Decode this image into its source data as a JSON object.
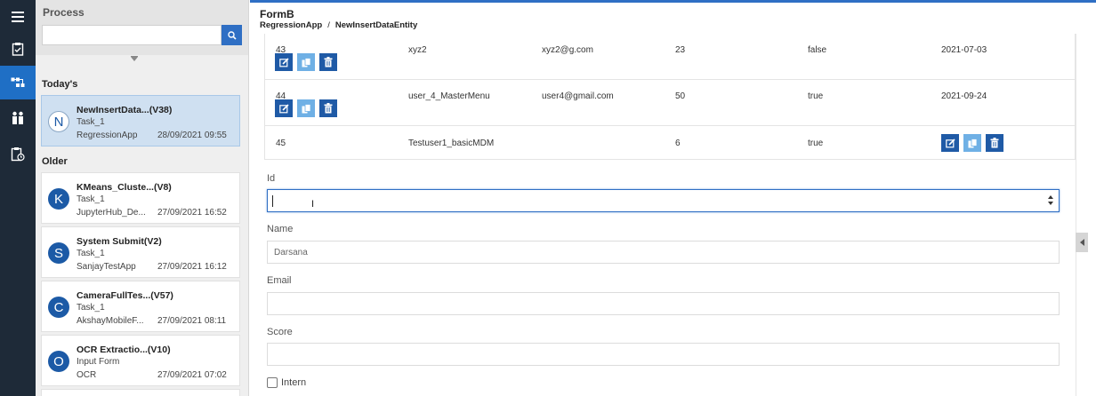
{
  "process_panel": {
    "title": "Process",
    "search_placeholder": "",
    "today_label": "Today's",
    "older_label": "Older",
    "today_items": [
      {
        "avatar": "N",
        "title": "NewInsertData...(V38)",
        "task": "Task_1",
        "app": "RegressionApp",
        "date": "28/09/2021 09:55",
        "selected": true
      }
    ],
    "older_items": [
      {
        "avatar": "K",
        "title": "KMeans_Cluste...(V8)",
        "task": "Task_1",
        "app": "JupyterHub_De...",
        "date": "27/09/2021 16:52"
      },
      {
        "avatar": "S",
        "title": "System Submit(V2)",
        "task": "Task_1",
        "app": "SanjayTestApp",
        "date": "27/09/2021 16:12"
      },
      {
        "avatar": "C",
        "title": "CameraFullTes...(V57)",
        "task": "Task_1",
        "app": "AkshayMobileF...",
        "date": "27/09/2021 08:11"
      },
      {
        "avatar": "O",
        "title": "OCR Extractio...(V10)",
        "task": "Input Form",
        "app": "OCR",
        "date": "27/09/2021 07:02"
      }
    ]
  },
  "rail": {
    "icons": [
      "menu-icon",
      "clipboard-icon",
      "process-flow-icon",
      "users-icon",
      "clipboard-clock-icon"
    ],
    "active_color": "#1f6fc5"
  },
  "header": {
    "title": "FormB",
    "breadcrumb": [
      "RegressionApp",
      "/",
      "NewInsertDataEntity"
    ]
  },
  "grid": {
    "rows": [
      {
        "id": "43",
        "name": "xyz2",
        "email": "xyz2@g.com",
        "score": "23",
        "intern": "false",
        "date": "2021-07-03"
      },
      {
        "id": "44",
        "name": "user_4_MasterMenu",
        "email": "user4@gmail.com",
        "score": "50",
        "intern": "true",
        "date": "2021-09-24"
      },
      {
        "id": "45",
        "name": "Testuser1_basicMDM",
        "email": "",
        "score": "6",
        "intern": "true",
        "date": ""
      }
    ]
  },
  "form": {
    "id_label": "Id",
    "id_value": "",
    "name_label": "Name",
    "name_value": "Darsana",
    "email_label": "Email",
    "email_value": "",
    "score_label": "Score",
    "score_value": "",
    "intern_label": "Intern",
    "intern_checked": false
  },
  "colors": {
    "accent": "#2f6fc4",
    "rail_bg": "#1e2a38",
    "selected_card": "#cfe0f1",
    "action_dark": "#1f5aa6",
    "action_light": "#6fb0e5"
  }
}
